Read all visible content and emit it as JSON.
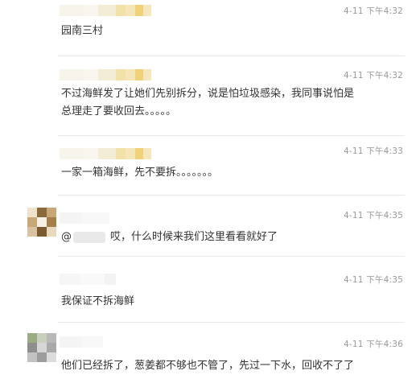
{
  "comments": [
    {
      "time": "4-11 下午4:32",
      "text": "园南三村"
    },
    {
      "time": "4-11 下午4:32",
      "lines": [
        "不过海鲜发了让她们先别拆分，说是怕垃圾感染，我同事说怕是",
        "总理走了要收回去。。。。。"
      ]
    },
    {
      "time": "4-11 下午4:33",
      "text": "一家一箱海鲜，先不要拆。。。。。。。"
    },
    {
      "time": "4-11 下午4:35",
      "at": "@",
      "text": "哎，什么时候来我们这里看看就好了"
    },
    {
      "time": "4-11 下午4:35",
      "text": "我保证不拆海鲜"
    },
    {
      "time": "4-11 下午4:36",
      "text": "他们已经拆了，葱姜都不够也不管了，先过一下水，回收不了了"
    }
  ],
  "colors": {
    "name_blur_light": "#f6f2e4",
    "name_blur_yellow": "#f2df9c",
    "name_blur_gold": "#f0d27a",
    "name_blur_grey": "#eeeeee",
    "avatar_brown": "#8a6a3c",
    "avatar_tan": "#c9a878",
    "avatar_cream": "#efe3cc",
    "avatar_olive": "#9bab84",
    "avatar_grey": "#b8b8b8"
  }
}
